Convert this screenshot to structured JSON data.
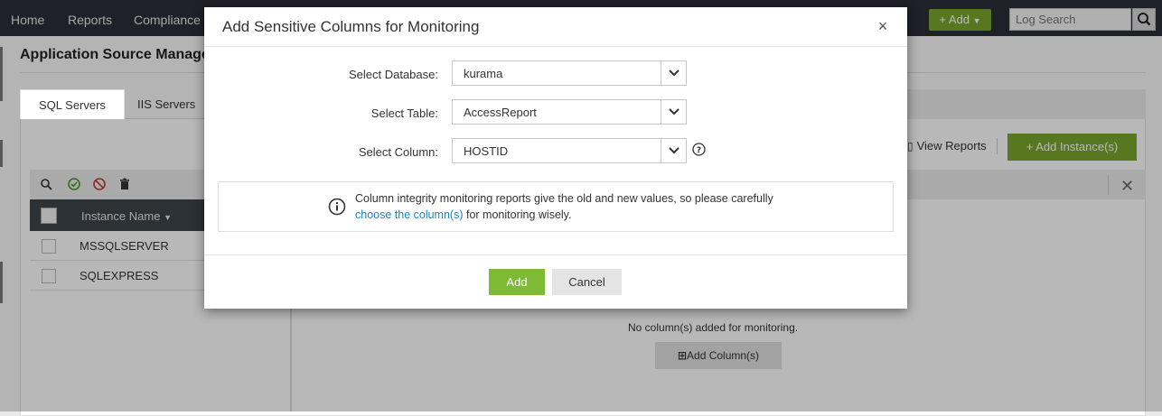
{
  "nav": {
    "items": [
      "Home",
      "Reports",
      "Compliance"
    ],
    "add_label": "+ Add",
    "search_placeholder": "Log Search"
  },
  "page": {
    "title": "Application Source Managen",
    "tabs": [
      {
        "label": "SQL Servers",
        "active": true
      },
      {
        "label": "IIS Servers",
        "active": false
      }
    ],
    "view_reports": "View Reports",
    "add_instance": "+ Add Instance(s)",
    "table": {
      "header": "Instance Name",
      "rows": [
        "MSSQLSERVER",
        "SQLEXPRESS"
      ]
    },
    "no_columns_text": "No column(s) added for monitoring.",
    "add_columns": "Add Column(s)"
  },
  "modal": {
    "title": "Add Sensitive Columns for Monitoring",
    "close": "×",
    "fields": [
      {
        "label": "Select Database:",
        "value": "kurama"
      },
      {
        "label": "Select Table:",
        "value": "AccessReport"
      },
      {
        "label": "Select Column:",
        "value": "HOSTID"
      }
    ],
    "info": {
      "line1": "Column integrity monitoring reports give the old and new values, so please carefully",
      "link": "choose the column(s)",
      "line2_rest": " for monitoring wisely."
    },
    "add_button": "Add",
    "cancel_button": "Cancel"
  },
  "colors": {
    "nav_bg": "#2a2f36",
    "accent_green": "#7dbb35",
    "link_blue": "#1a85c8",
    "header_dark": "#3d444b"
  }
}
